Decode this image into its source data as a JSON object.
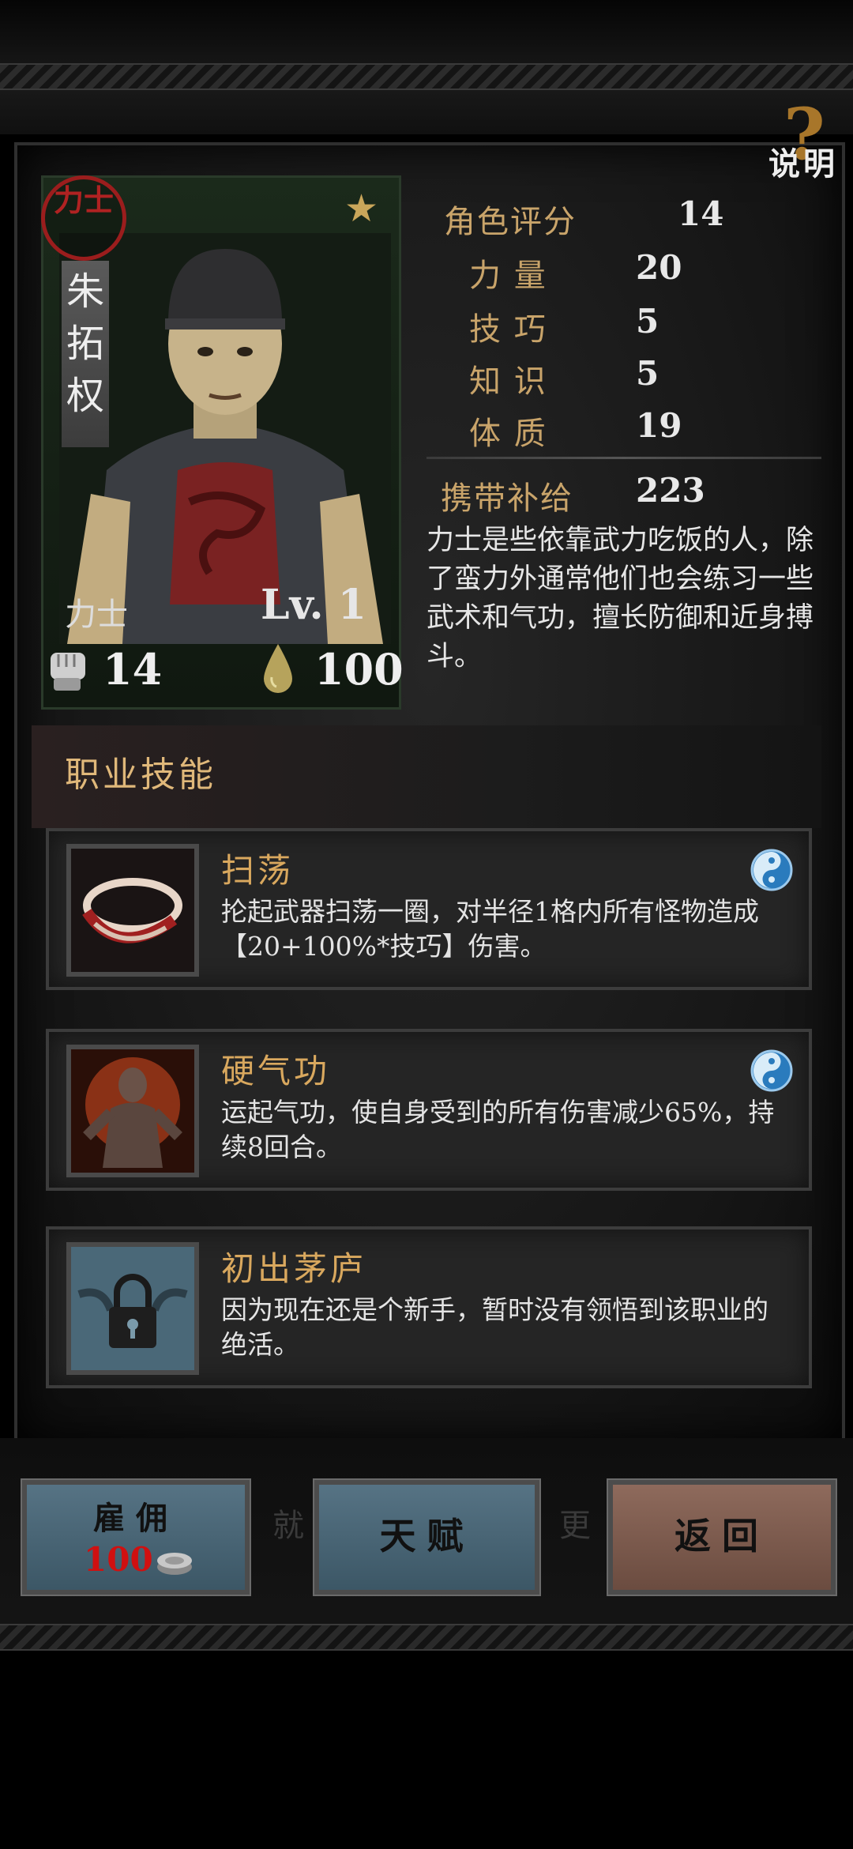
{
  "help": {
    "label": "说明",
    "mark": "?"
  },
  "character": {
    "class_seal": "力士",
    "name_chars": [
      "朱",
      "拓",
      "权"
    ],
    "class_label": "力士",
    "level": "Lv. 1",
    "power": "14",
    "water": "100"
  },
  "stats": [
    {
      "label": "角色评分",
      "value": "14"
    },
    {
      "label": "力 量",
      "value": "20"
    },
    {
      "label": "技 巧",
      "value": "5"
    },
    {
      "label": "知 识",
      "value": "5"
    },
    {
      "label": "体 质",
      "value": "19"
    },
    {
      "label": "携带补给",
      "value": "223"
    }
  ],
  "description": "力士是些依靠武力吃饭的人，除了蛮力外通常他们也会练习一些武术和气功，擅长防御和近身搏斗。",
  "skills_header": "职业技能",
  "skills": [
    {
      "title": "扫荡",
      "text": "抡起武器扫荡一圈，对半径1格内所有怪物造成【20+100%*技巧】伤害。",
      "icon": "sweep-icon",
      "has_type": true
    },
    {
      "title": "硬气功",
      "text": "运起气功，使自身受到的所有伤害减少65%，持续8回合。",
      "icon": "qigong-icon",
      "has_type": true
    },
    {
      "title": "初出茅庐",
      "text": "因为现在还是个新手，暂时没有领悟到该职业的绝活。",
      "icon": "locked-icon",
      "has_type": false
    }
  ],
  "buttons": {
    "hire_label": "雇佣",
    "hire_cost": "100",
    "talent_label": "天赋",
    "back_label": "返回"
  },
  "background_text": {
    "left": "就",
    "right": "更"
  },
  "colors": {
    "accent_gold": "#c9a46a",
    "seal_red": "#b02222",
    "cost_red": "#d01010"
  }
}
